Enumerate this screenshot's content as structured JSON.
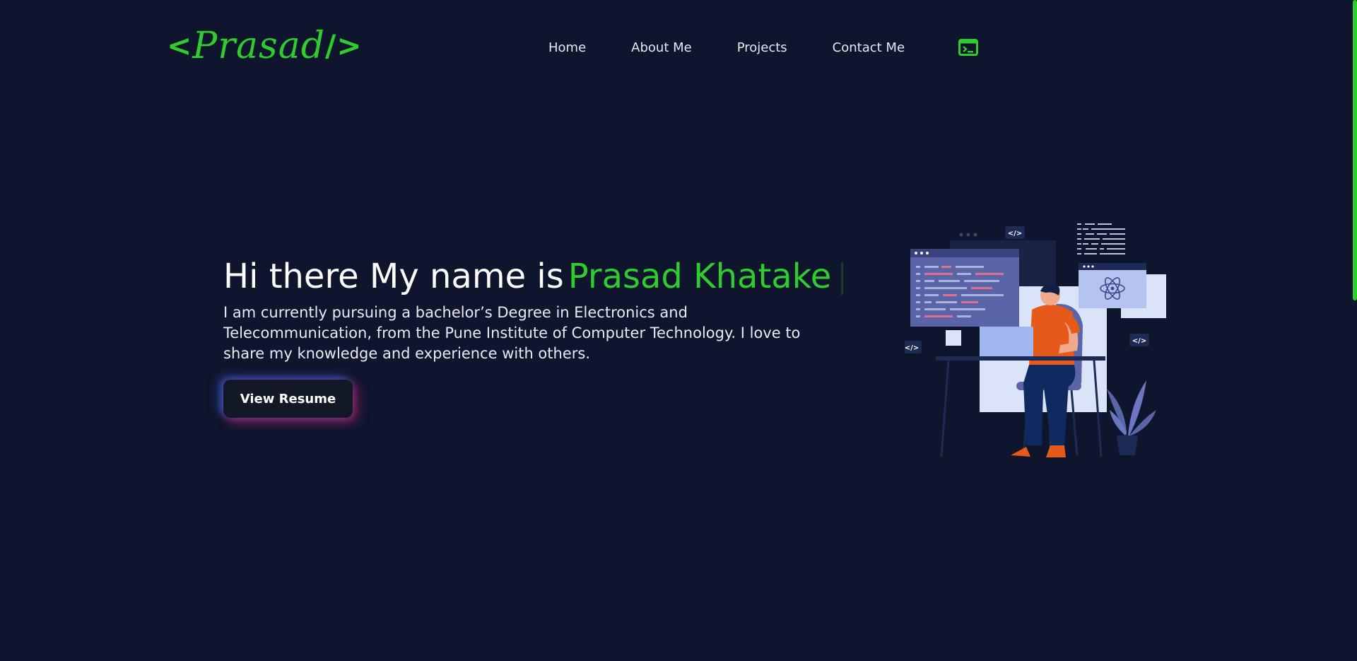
{
  "brand": {
    "logo_text": "Prasad",
    "logo_open": "<",
    "logo_close": "/>",
    "accent_color": "#2ecc2e",
    "background_color": "#0f152d"
  },
  "nav": {
    "items": [
      {
        "label": "Home"
      },
      {
        "label": "About Me"
      },
      {
        "label": "Projects"
      },
      {
        "label": "Contact Me"
      }
    ],
    "terminal_icon": "terminal-icon"
  },
  "hero": {
    "greeting": "Hi there My name is",
    "name": "Prasad Khatake",
    "description": "I am currently pursuing a bachelor’s Degree in Electronics and Telecommunication, from the Pune Institute of Computer Technology. I love to share my knowledge and experience with others.",
    "resume_button": "View Resume"
  },
  "illustration": {
    "code_tag": "</>"
  }
}
